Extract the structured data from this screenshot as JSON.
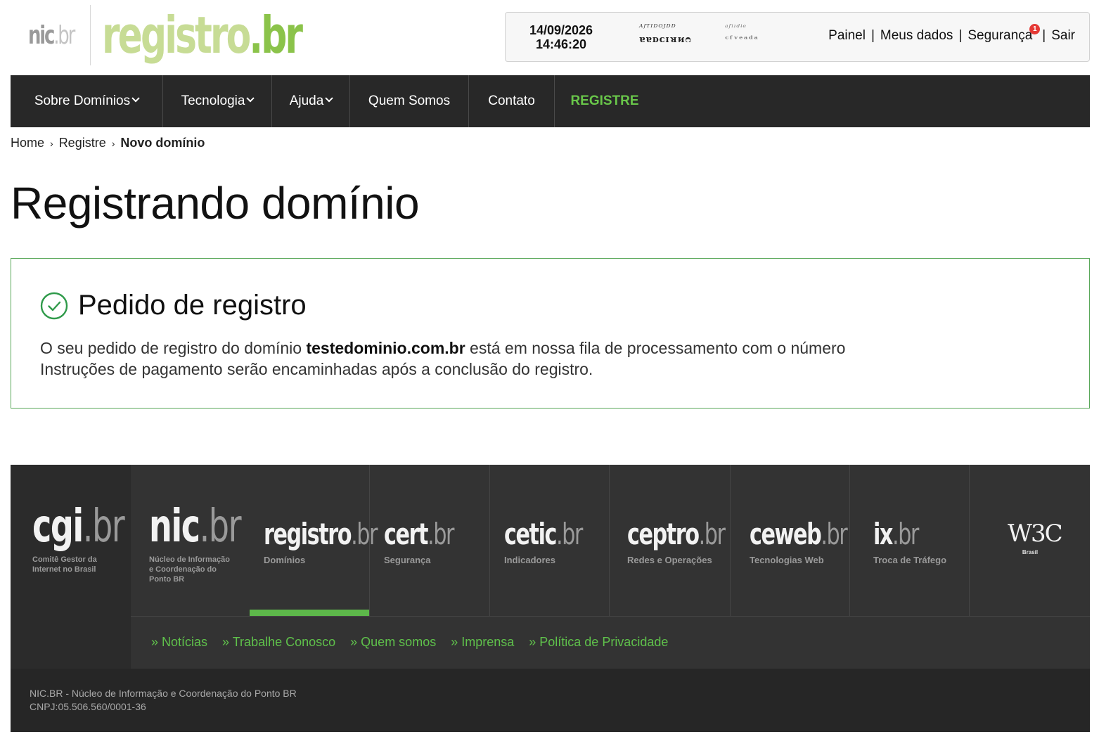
{
  "header": {
    "logo_nic": "nic",
    "logo_nic_br": ".br",
    "logo_registro": "registro",
    "logo_registro_br": ".br",
    "date": "14/09/2026",
    "time": "14:46:20",
    "captcha": {
      "line1a": "ᴬᶠᵀᴵᴰᴼᴶᴰᴰ",
      "line2a": "ɐɐᴅᴄɪᴚᴎᴒ",
      "line1b": "ᵃᶠⁱᶦᵈᶤᵉ",
      "line2b": "ᶜᶠᵛᵉᵃᵈᵃ"
    },
    "links": {
      "painel": "Painel",
      "meus_dados": "Meus dados",
      "seguranca": "Segurança",
      "seguranca_badge": "1",
      "sair": "Sair",
      "separator": "|"
    }
  },
  "nav": {
    "sobre_dominios": "Sobre Domínios",
    "tecnologia": "Tecnologia",
    "ajuda": "Ajuda",
    "quem_somos": "Quem Somos",
    "contato": "Contato",
    "registre": "REGISTRE"
  },
  "breadcrumb": {
    "home": "Home",
    "registre": "Registre",
    "current": "Novo domínio",
    "arrow": "›"
  },
  "page": {
    "title": "Registrando domínio"
  },
  "panel": {
    "title": "Pedido de registro",
    "text_before": "O seu pedido de registro do domínio ",
    "domain": "testedominio.com.br",
    "text_after": " está em nossa fila de processamento com o número",
    "text_line2": "Instruções de pagamento serão encaminhadas após a conclusão do registro."
  },
  "footer": {
    "cgi": {
      "logo": "cgi",
      "br": ".br",
      "sub1": "Comitê Gestor da",
      "sub2": "Internet no Brasil"
    },
    "nic": {
      "logo": "nic",
      "br": ".br",
      "sub1": "Núcleo de Informação",
      "sub2": "e Coordenação do",
      "sub3": "Ponto BR"
    },
    "orgs": [
      {
        "logo": "registro",
        "br": ".br",
        "sub": "Domínios"
      },
      {
        "logo": "cert",
        "br": ".br",
        "sub": "Segurança"
      },
      {
        "logo": "cetic",
        "br": ".br",
        "sub": "Indicadores"
      },
      {
        "logo": "ceptro",
        "br": ".br",
        "sub": "Redes e Operações"
      },
      {
        "logo": "ceweb",
        "br": ".br",
        "sub": "Tecnologias Web"
      },
      {
        "logo": "ix",
        "br": ".br",
        "sub": "Troca de Tráfego"
      }
    ],
    "w3c": {
      "logo": "W3C",
      "sub": "Brasil"
    },
    "links": {
      "noticias": "» Notícias",
      "trabalhe": "» Trabalhe Conosco",
      "quem_somos": "» Quem somos",
      "imprensa": "» Imprensa",
      "privacidade": "» Política de Privacidade"
    },
    "bottom_line1": "NIC.BR - Núcleo de Informação e Coordenação do Ponto BR",
    "bottom_line2": "CNPJ:05.506.560/0001-36"
  },
  "colors": {
    "brand_green": "#69c64a",
    "logo_light_green": "#c7dc95",
    "nav_bg": "#282828",
    "panel_border": "#5aa85a",
    "footer_bg": "#333333",
    "footer_link": "#5fc14b",
    "badge_red": "#e53935"
  }
}
